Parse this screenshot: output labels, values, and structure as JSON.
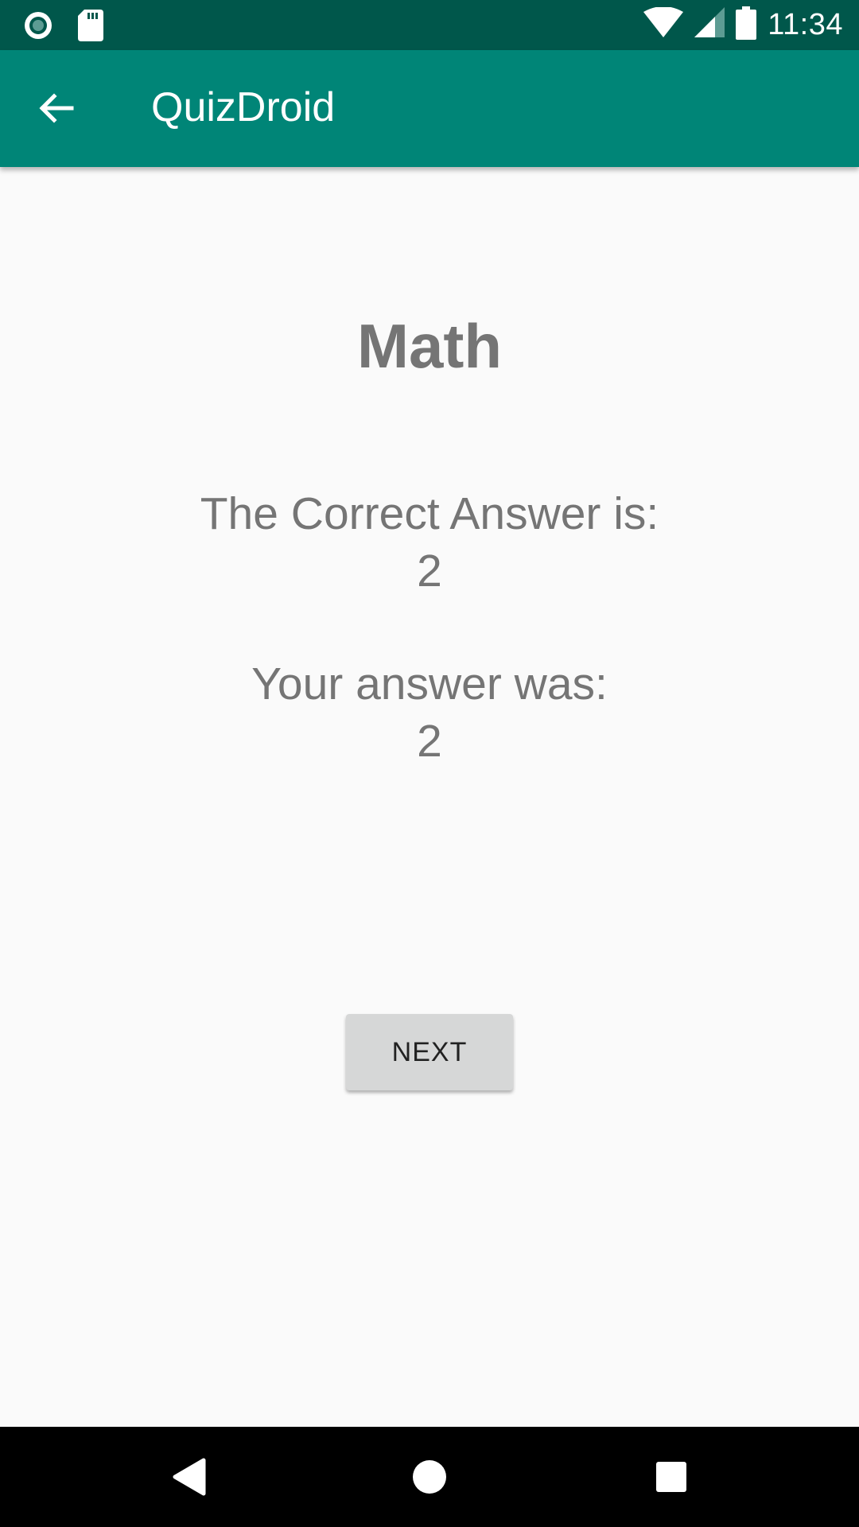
{
  "status_bar": {
    "time": "11:34",
    "icons": [
      "record-icon",
      "sd-card-icon",
      "wifi-icon",
      "signal-icon",
      "battery-icon"
    ]
  },
  "app_bar": {
    "title": "QuizDroid",
    "back_icon": "arrow-back-icon",
    "color": "#008577"
  },
  "main": {
    "subject": "Math",
    "correct_label": "The Correct Answer is:",
    "correct_value": "2",
    "user_label": "Your answer was:",
    "user_value": "2",
    "next_label": "NEXT"
  },
  "nav_bar": {
    "icons": [
      "back-triangle-icon",
      "home-circle-icon",
      "recents-square-icon"
    ]
  }
}
